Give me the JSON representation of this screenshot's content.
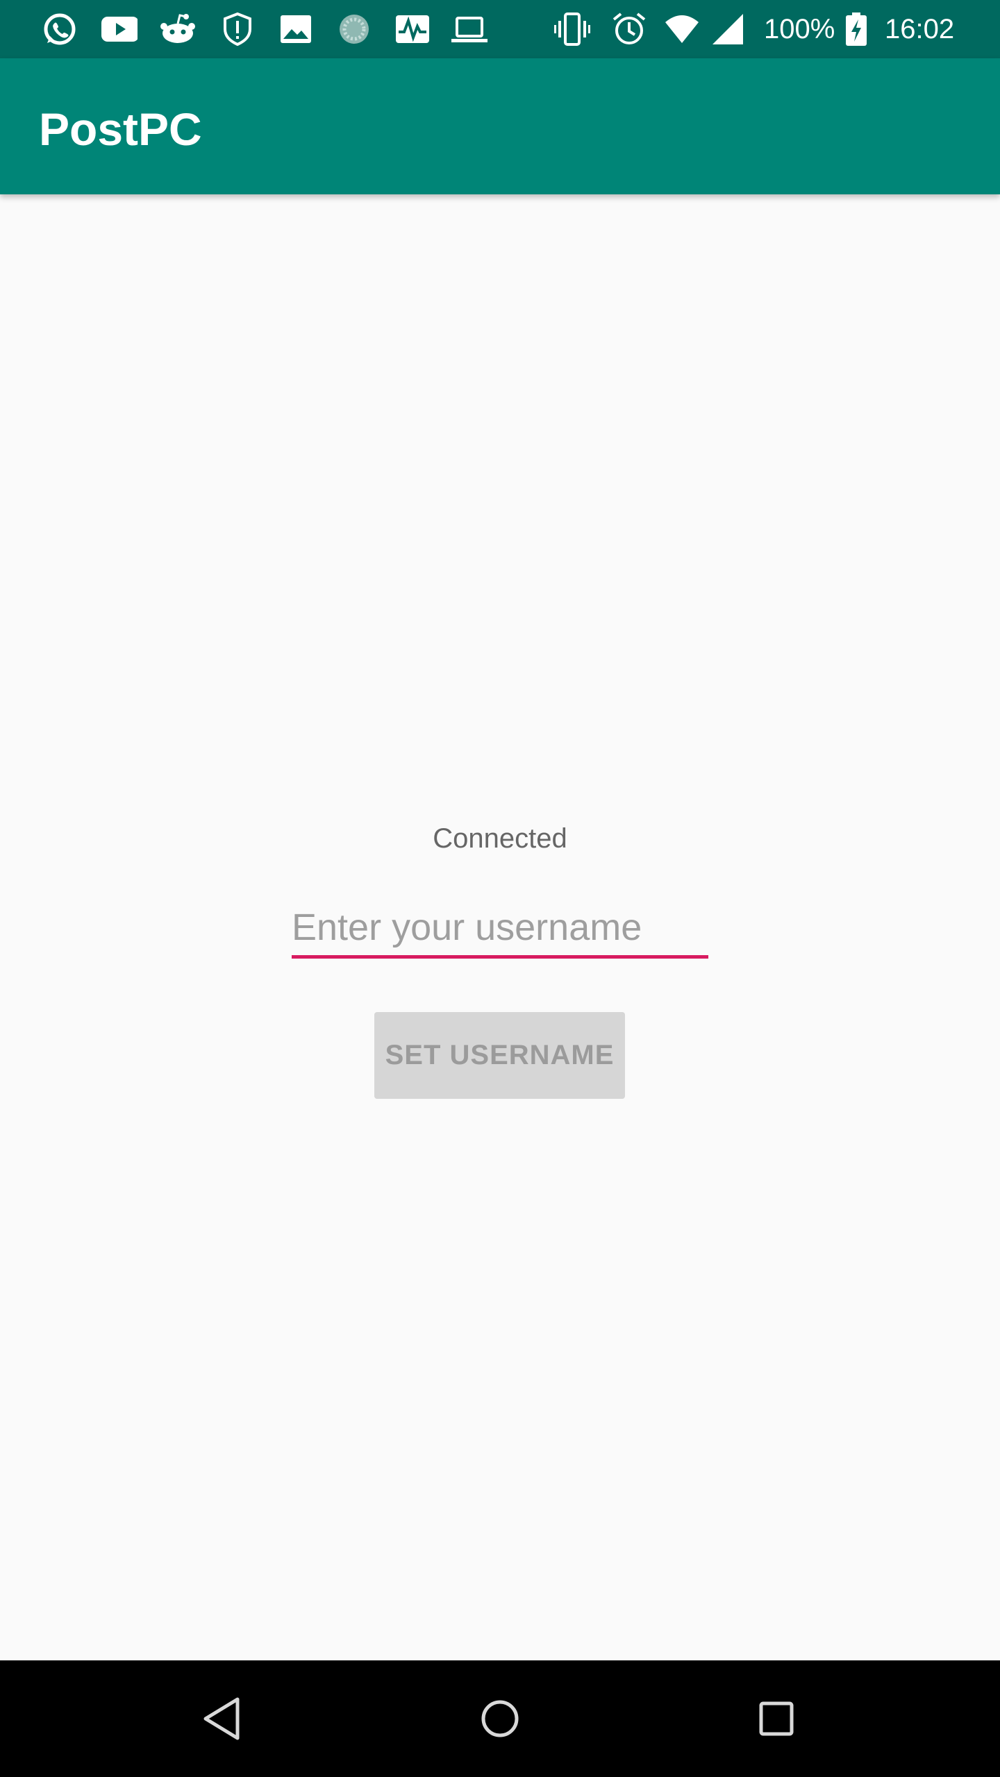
{
  "status_bar": {
    "icons": [
      "whatsapp-icon",
      "youtube-icon",
      "reddit-icon",
      "shield-alert-icon",
      "image-icon",
      "loading-circle-icon",
      "activity-icon",
      "laptop-icon",
      "vibrate-icon",
      "alarm-icon",
      "wifi-icon",
      "signal-icon",
      "battery-charging-icon"
    ],
    "battery": "100%",
    "time": "16:02",
    "color": "#00695f"
  },
  "app_bar": {
    "title": "PostPC",
    "color": "#008577"
  },
  "main": {
    "status": "Connected",
    "username_placeholder": "Enter your username",
    "username_value": "",
    "set_button_label": "SET USERNAME",
    "accent_color": "#d81b60"
  },
  "nav_bar": {
    "icons": [
      "back-icon",
      "home-icon",
      "recents-icon"
    ]
  }
}
